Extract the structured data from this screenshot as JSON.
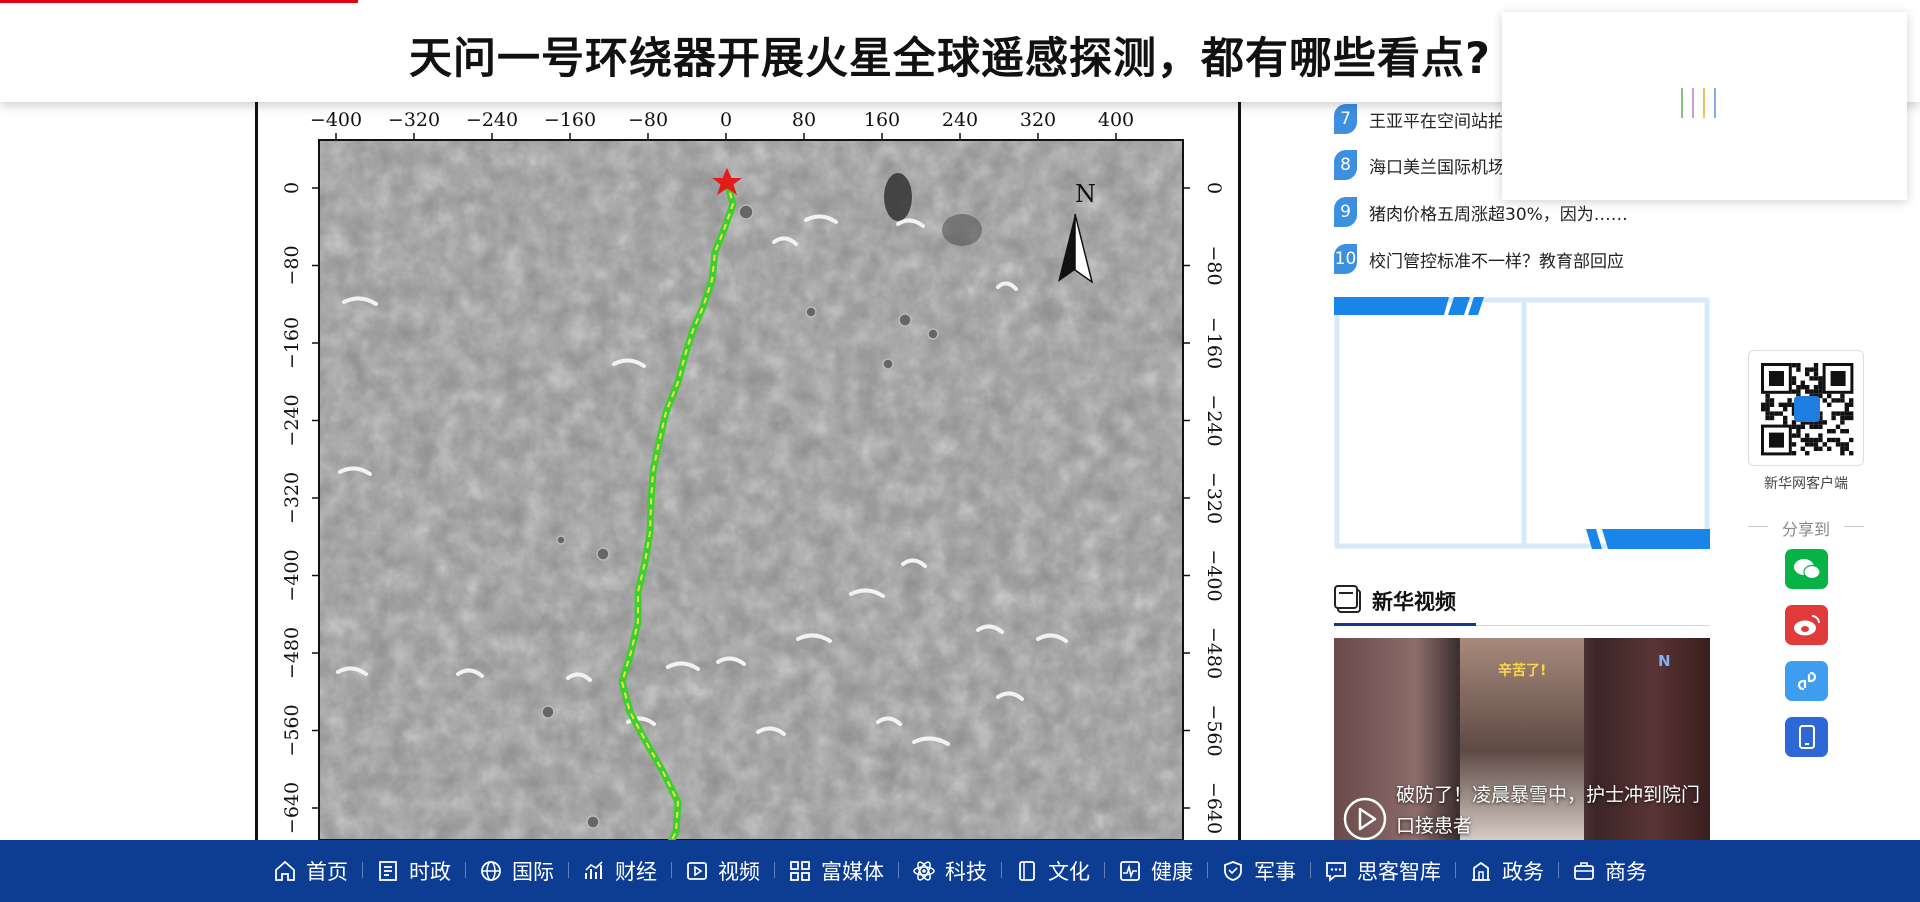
{
  "header": {
    "title": "天问一号环绕器开展火星全球遥感探测，都有哪些看点?"
  },
  "figure": {
    "top_ticks": [
      "−400",
      "−320",
      "−240",
      "−160",
      "−80",
      "0",
      "80",
      "160",
      "240",
      "320",
      "400"
    ],
    "side_ticks": [
      "0",
      "−80",
      "−160",
      "−240",
      "−320",
      "−400",
      "−480",
      "−560",
      "−640"
    ],
    "north_label": "N"
  },
  "ranking": [
    {
      "rank": "7",
      "text": "王亚平在空间站拍"
    },
    {
      "rank": "8",
      "text": "海口美兰国际机场"
    },
    {
      "rank": "9",
      "text": "猪肉价格五周涨超30%，因为……"
    },
    {
      "rank": "10",
      "text": "校门管控标准不一样？教育部回应"
    }
  ],
  "video_section": {
    "title": "新华视频",
    "caption": "破防了！凌晨暴雪中，护士冲到院门口接患者",
    "thumb_text": "辛苦了!"
  },
  "share": {
    "qr_label": "新华网客户端",
    "share_label": "分享到",
    "buttons": [
      {
        "name": "wechat",
        "color": "#07b346",
        "icon": "wechat-icon"
      },
      {
        "name": "weibo",
        "color": "#e03a3a",
        "icon": "weibo-icon"
      },
      {
        "name": "miniapp",
        "color": "#3f9df0",
        "icon": "link-icon"
      },
      {
        "name": "mobile",
        "color": "#3067d6",
        "icon": "phone-icon"
      }
    ]
  },
  "nav": [
    {
      "label": "首页",
      "icon": "home-icon"
    },
    {
      "label": "时政",
      "icon": "document-icon"
    },
    {
      "label": "国际",
      "icon": "globe-icon"
    },
    {
      "label": "财经",
      "icon": "chart-icon"
    },
    {
      "label": "视频",
      "icon": "video-icon"
    },
    {
      "label": "富媒体",
      "icon": "grid-icon"
    },
    {
      "label": "科技",
      "icon": "atom-icon"
    },
    {
      "label": "文化",
      "icon": "book-icon"
    },
    {
      "label": "健康",
      "icon": "health-icon"
    },
    {
      "label": "军事",
      "icon": "shield-icon"
    },
    {
      "label": "思客智库",
      "icon": "chat-icon"
    },
    {
      "label": "政务",
      "icon": "building-icon"
    },
    {
      "label": "商务",
      "icon": "briefcase-icon"
    }
  ],
  "colors": {
    "nav_bg": "#0c3d92",
    "accent": "#e60012",
    "rank_badge": "#3d8fe0",
    "route": "#3ccf2f"
  }
}
